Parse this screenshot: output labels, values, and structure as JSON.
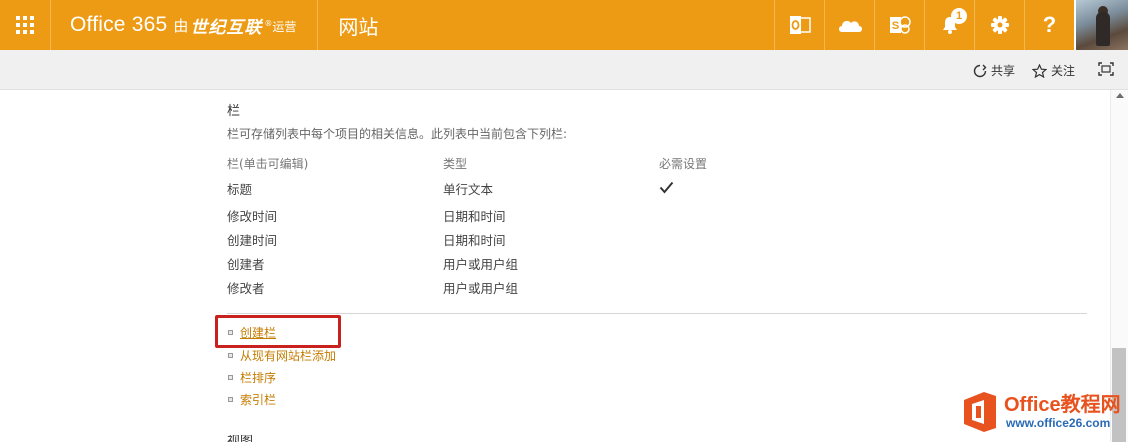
{
  "suitebar": {
    "brand_name": "Office 365",
    "brand_you": "由",
    "brand_partner": "世纪互联",
    "brand_registered": "®",
    "brand_suffix": "运营",
    "site_title": "网站",
    "notification_count": "1",
    "help_label": "?",
    "colors": {
      "background": "#ed9b14",
      "foreground": "#ffffff"
    },
    "icons": [
      "app-launcher-icon",
      "outlook-icon",
      "onedrive-icon",
      "sharepoint-icon",
      "bell-icon",
      "gear-icon",
      "help-icon",
      "avatar"
    ]
  },
  "commands": {
    "share_label": "共享",
    "follow_label": "关注",
    "icons": [
      "share-icon",
      "star-icon",
      "focus-icon"
    ]
  },
  "columns_section": {
    "title": "栏",
    "description": "栏可存储列表中每个项目的相关信息。此列表中当前包含下列栏:",
    "headers": {
      "name": "栏(单击可编辑)",
      "type": "类型",
      "required": "必需设置"
    },
    "rows": [
      {
        "name": "标题",
        "type": "单行文本",
        "required": true
      },
      {
        "name": "修改时间",
        "type": "日期和时间",
        "required": false
      },
      {
        "name": "创建时间",
        "type": "日期和时间",
        "required": false
      },
      {
        "name": "创建者",
        "type": "用户或用户组",
        "required": false
      },
      {
        "name": "修改者",
        "type": "用户或用户组",
        "required": false
      }
    ],
    "links": [
      {
        "label": "创建栏"
      },
      {
        "label": "从现有网站栏添加"
      },
      {
        "label": "栏排序"
      },
      {
        "label": "索引栏"
      }
    ],
    "link_color": "#c57c00",
    "highlight_color": "#c9211e"
  },
  "next_section": {
    "title_partial": "视图"
  },
  "watermark": {
    "main": "Office教程网",
    "sub": "www.office26.com"
  }
}
